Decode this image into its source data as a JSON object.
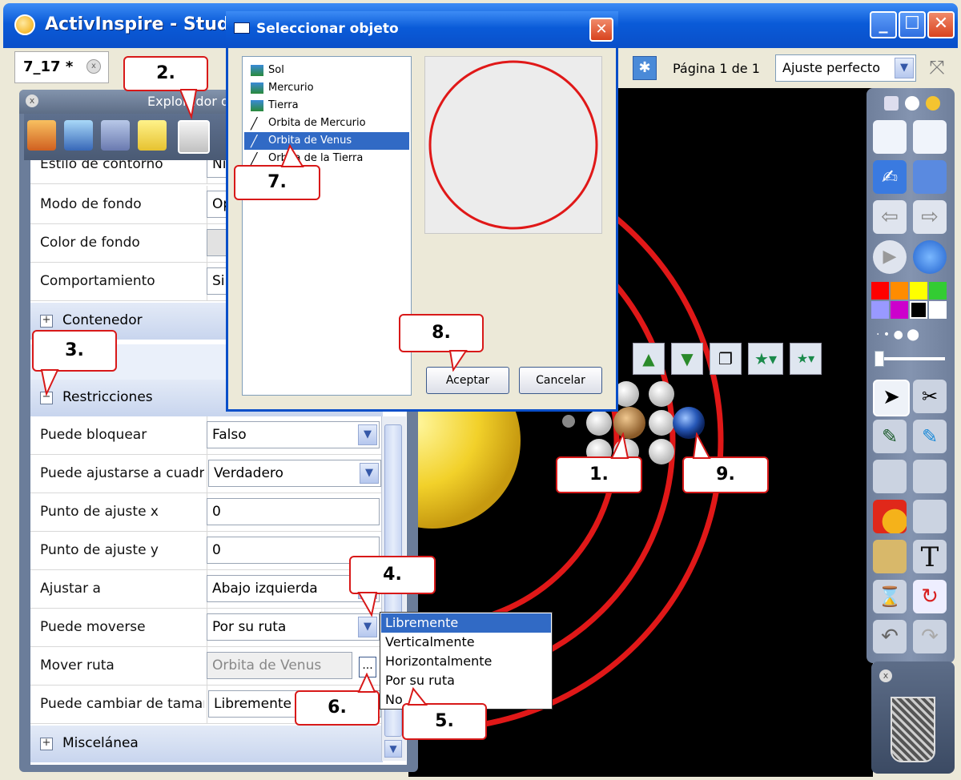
{
  "window": {
    "title": "ActivInspire - Studio",
    "colors": {
      "titlebar": "#0a5bd8",
      "canvas": "#000000",
      "orbit": "#e01818"
    }
  },
  "tab": {
    "label": "7_17 *",
    "close_icon": "x-icon"
  },
  "page_nav": {
    "page_label": "Página 1 de 1",
    "zoom_value": "Ajuste perfecto"
  },
  "explorer": {
    "title": "Explorador de",
    "tabs": [
      "page-browser-icon",
      "resource-browser-icon",
      "object-browser-icon",
      "notes-browser-icon",
      "property-browser-icon"
    ]
  },
  "properties": {
    "top_rows": [
      {
        "label": "Estilo de contorno",
        "value": "Ni"
      },
      {
        "label": "Modo de fondo",
        "value": "Op"
      },
      {
        "label": "Color de fondo",
        "value": ""
      },
      {
        "label": "Comportamiento",
        "value": "Si"
      }
    ],
    "section_container": "Contenedor",
    "section_restrictions": "Restricciones",
    "restrictions": [
      {
        "label": "Puede bloquear",
        "value": "Falso",
        "dropdown": true
      },
      {
        "label": "Puede ajustarse a cuadrí",
        "value": "Verdadero",
        "dropdown": true
      },
      {
        "label": "Punto de ajuste x",
        "value": "0",
        "dropdown": false
      },
      {
        "label": "Punto de ajuste y",
        "value": "0",
        "dropdown": false
      },
      {
        "label": "Ajustar a",
        "value": "Abajo izquierda",
        "dropdown": true
      },
      {
        "label": "Puede moverse",
        "value": "Por su ruta",
        "dropdown": true
      },
      {
        "label": "Mover ruta",
        "value": "Orbita de Venus",
        "dropdown": false
      },
      {
        "label": "Puede cambiar de tamañ",
        "value": "Libremente",
        "dropdown": true
      }
    ],
    "browse_button": "...",
    "section_misc": "Miscelánea"
  },
  "move_options": {
    "items": [
      "Libremente",
      "Verticalmente",
      "Horizontalmente",
      "Por su ruta",
      "No"
    ],
    "highlighted": "Libremente"
  },
  "dialog": {
    "title": "Seleccionar objeto",
    "objects": [
      {
        "label": "Sol",
        "icon": "image-icon"
      },
      {
        "label": "Mercurio",
        "icon": "image-icon"
      },
      {
        "label": "Tierra",
        "icon": "image-icon"
      },
      {
        "label": "Orbita de Mercurio",
        "icon": "pen-icon"
      },
      {
        "label": "Orbita de Venus",
        "icon": "pen-icon",
        "selected": true
      },
      {
        "label": "Orbita de la Tierra",
        "icon": "pen-icon"
      }
    ],
    "accept_label": "Aceptar",
    "cancel_label": "Cancelar"
  },
  "callouts": [
    "1.",
    "2.",
    "3.",
    "4.",
    "5.",
    "6.",
    "7.",
    "8.",
    "9."
  ],
  "palette_colors": [
    "#ff0000",
    "#ff8c00",
    "#ffff00",
    "#33cc33",
    "#9999ff",
    "#cc00cc",
    "#000000",
    "#ffffff"
  ]
}
